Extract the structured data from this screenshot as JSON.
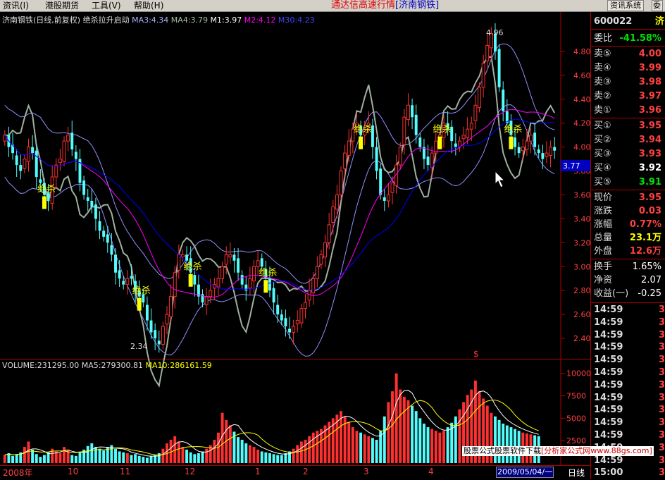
{
  "menubar": {
    "items": [
      "资讯(I)",
      "港股期货",
      "工具(V)",
      "帮助(H)"
    ],
    "title": "通达信高速行情",
    "title_code": "[济南钢铁]",
    "btn_info": "资讯系统",
    "btn_commit": "委"
  },
  "legend": {
    "name": "济南钢铁(日线,前复权) 绝杀拉升启动",
    "ma3": "MA3:4.34",
    "ma4": "MA4:3.79",
    "m1": "M1:3.97",
    "m2": "M2:4.12",
    "m30": "M30:4.23"
  },
  "vol_legend": {
    "volume": "VOLUME:231295.00",
    "ma5": "MA5:279300.81",
    "ma10": "MA10:286161.59"
  },
  "colors": {
    "up": "#ff3030",
    "down": "#54fcfc",
    "ma_a": "#ffffff",
    "ma_b": "#ffff00",
    "ma_c": "#ff00ff",
    "ma_d": "#0000ff",
    "band": "#9090ff",
    "osc": "#a0b0a0"
  },
  "annotations": {
    "signal": "绝杀",
    "high_label": "4.96",
    "low_label": "2.34",
    "dollar": "$",
    "cursor_price": "3.77"
  },
  "chart_data": {
    "type": "candlestick",
    "price_axis": [
      4.8,
      4.6,
      4.4,
      4.2,
      4.0,
      3.8,
      3.6,
      3.4,
      3.2,
      3.0,
      2.8,
      2.6,
      2.4
    ],
    "price_range": [
      2.3,
      5.0
    ],
    "volume_axis": [
      10000,
      7500,
      5000,
      2500
    ],
    "volume_range": [
      0,
      11000
    ],
    "x_ticks": [
      "2008年",
      "10",
      "11",
      "12",
      "1",
      "2",
      "3",
      "4",
      "5"
    ],
    "close": [
      4.1,
      4.0,
      3.95,
      3.85,
      3.8,
      3.9,
      4.0,
      3.95,
      3.75,
      3.7,
      3.6,
      3.55,
      3.75,
      3.85,
      3.9,
      4.05,
      4.1,
      3.98,
      3.9,
      3.7,
      3.6,
      3.55,
      3.5,
      3.4,
      3.3,
      3.25,
      3.2,
      3.1,
      2.95,
      2.9,
      2.85,
      2.9,
      2.9,
      2.8,
      2.75,
      2.7,
      2.55,
      2.45,
      2.4,
      2.35,
      2.5,
      2.6,
      2.75,
      2.95,
      3.1,
      3.1,
      3.05,
      2.95,
      2.85,
      2.75,
      2.7,
      2.75,
      2.8,
      2.85,
      2.9,
      3.0,
      3.1,
      3.1,
      3.05,
      2.95,
      2.85,
      2.8,
      2.9,
      3.0,
      3.05,
      3.0,
      2.9,
      2.8,
      2.7,
      2.6,
      2.55,
      2.5,
      2.45,
      2.5,
      2.55,
      2.65,
      2.7,
      2.8,
      2.9,
      3.0,
      3.1,
      3.2,
      3.35,
      3.5,
      3.6,
      3.8,
      3.95,
      4.05,
      4.15,
      4.2,
      4.1,
      4.15,
      4.2,
      4.0,
      3.8,
      3.6,
      3.55,
      3.6,
      3.7,
      3.85,
      4.0,
      4.25,
      4.35,
      4.25,
      4.1,
      4.0,
      3.9,
      3.85,
      3.95,
      4.05,
      4.1,
      4.2,
      4.15,
      4.05,
      4.0,
      4.05,
      4.1,
      4.15,
      4.2,
      4.35,
      4.5,
      4.7,
      4.85,
      4.95,
      4.8,
      4.5,
      4.3,
      4.2,
      4.1,
      4.0,
      3.95,
      4.0,
      4.05,
      4.1,
      4.0,
      3.95,
      3.9,
      3.95,
      4.0,
      3.97
    ],
    "volume": [
      900,
      1100,
      800,
      1000,
      1200,
      1800,
      2400,
      1500,
      1000,
      700,
      900,
      1200,
      1600,
      1300,
      1100,
      1800,
      1500,
      900,
      800,
      1200,
      1500,
      1900,
      2200,
      1800,
      1600,
      1400,
      1800,
      2000,
      1600,
      1300,
      1200,
      1100,
      900,
      1000,
      800,
      700,
      600,
      800,
      900,
      1100,
      1600,
      2200,
      2600,
      3000,
      2400,
      1800,
      1500,
      1200,
      1000,
      1100,
      1300,
      1600,
      2000,
      2600,
      3400,
      5600,
      4800,
      4200,
      3500,
      2900,
      2600,
      2200,
      2000,
      1800,
      1500,
      1300,
      1200,
      1100,
      1000,
      900,
      900,
      1100,
      1300,
      1600,
      2000,
      2400,
      2600,
      3000,
      3400,
      3600,
      3800,
      4200,
      4600,
      5000,
      5400,
      5800,
      5200,
      4600,
      4000,
      3600,
      3400,
      3200,
      3000,
      2800,
      2600,
      3600,
      5200,
      6800,
      8000,
      10000,
      8200,
      7400,
      7000,
      6400,
      5800,
      5000,
      4400,
      4000,
      3800,
      3600,
      3400,
      3600,
      4000,
      4500,
      5200,
      6000,
      6800,
      7600,
      8200,
      9200,
      8000,
      7200,
      6400,
      5600,
      5200,
      4800,
      4400,
      4200,
      4000,
      3800,
      3600,
      3400,
      3300,
      3200,
      3100,
      3000
    ]
  },
  "quote": {
    "code": "600022",
    "code_suffix": "济",
    "weibi_label": "委比",
    "weibi": "-41.58%",
    "asks": [
      {
        "label": "卖⑤",
        "price": "4.00"
      },
      {
        "label": "卖④",
        "price": "3.99"
      },
      {
        "label": "卖③",
        "price": "3.98"
      },
      {
        "label": "卖②",
        "price": "3.97"
      },
      {
        "label": "卖①",
        "price": "3.96"
      }
    ],
    "bids": [
      {
        "label": "买①",
        "price": "3.95"
      },
      {
        "label": "买②",
        "price": "3.94"
      },
      {
        "label": "买③",
        "price": "3.93"
      },
      {
        "label": "买④",
        "price": "3.92"
      },
      {
        "label": "买⑤",
        "price": "3.91"
      }
    ],
    "stats": [
      {
        "label": "现价",
        "value": "3.95"
      },
      {
        "label": "涨跌",
        "value": "0.03"
      },
      {
        "label": "涨幅",
        "value": "0.77%"
      },
      {
        "label": "总量",
        "value": "23.1万"
      },
      {
        "label": "外盘",
        "value": "12.6万"
      }
    ],
    "stats2": [
      {
        "label": "换手",
        "value": "1.65%"
      },
      {
        "label": "净资",
        "value": "2.07"
      },
      {
        "label": "收益(一)",
        "value": "-0.25"
      }
    ],
    "ticks": [
      {
        "time": "14:59",
        "price": "3.9"
      },
      {
        "time": "14:59",
        "price": "3.9"
      },
      {
        "time": "14:59",
        "price": "3.9"
      },
      {
        "time": "14:59",
        "price": "3.9"
      },
      {
        "time": "14:59",
        "price": "3.9"
      },
      {
        "time": "14:59",
        "price": "3.9"
      },
      {
        "time": "14:59",
        "price": "3.9"
      },
      {
        "time": "14:59",
        "price": "3.9"
      },
      {
        "time": "14:59",
        "price": "3.9"
      },
      {
        "time": "14:59",
        "price": "3.9"
      },
      {
        "time": "14:59",
        "price": "3.9"
      },
      {
        "time": "14:59",
        "price": "3.9"
      },
      {
        "time": "14:59",
        "price": "3.9"
      },
      {
        "time": "15:00",
        "price": "3.9"
      }
    ]
  },
  "bottombar": {
    "date": "2009/05/04/一",
    "period": "日线"
  },
  "watermark": {
    "text": "股票公式股票软件下载",
    "url": "[分析家公式网www.88gs.com]"
  }
}
